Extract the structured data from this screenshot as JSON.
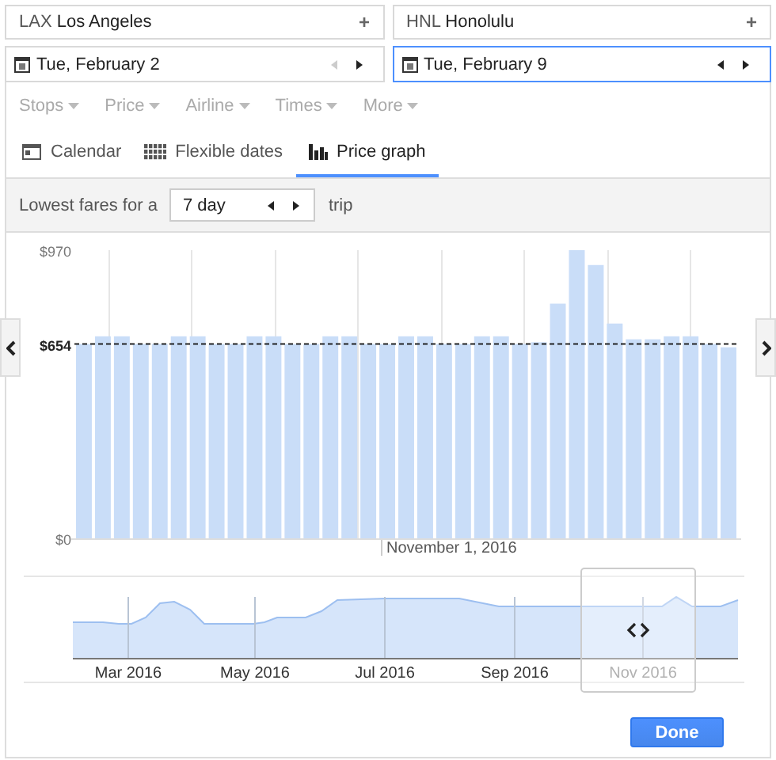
{
  "airports": [
    {
      "code": "LAX",
      "city": "Los Angeles",
      "action": "+"
    },
    {
      "code": "HNL",
      "city": "Honolulu",
      "action": "+"
    }
  ],
  "dates": [
    {
      "label": "Tue, February 2",
      "selected": false,
      "prev_disabled": true
    },
    {
      "label": "Tue, February 9",
      "selected": true,
      "prev_disabled": false
    }
  ],
  "filters": [
    {
      "label": "Stops",
      "disabled": true
    },
    {
      "label": "Price",
      "disabled": true
    },
    {
      "label": "Airline",
      "disabled": true
    },
    {
      "label": "Times",
      "disabled": true
    },
    {
      "label": "More",
      "disabled": true
    }
  ],
  "tabs": [
    {
      "kind": "calendar",
      "label": "Calendar",
      "selected": false
    },
    {
      "kind": "grid",
      "label": "Flexible dates",
      "selected": false
    },
    {
      "kind": "graph",
      "label": "Price graph",
      "selected": true
    }
  ],
  "fare_bar": {
    "prefix": "Lowest fares for a",
    "duration": "7 day",
    "suffix": "trip"
  },
  "price_chart": {
    "chart_data": {
      "type": "bar",
      "values": [
        654,
        680,
        680,
        654,
        654,
        680,
        680,
        654,
        654,
        680,
        680,
        654,
        654,
        680,
        680,
        654,
        654,
        680,
        680,
        654,
        654,
        680,
        680,
        654,
        660,
        790,
        970,
        920,
        723,
        670,
        670,
        680,
        680,
        654,
        643
      ],
      "ylim": [
        0,
        970
      ],
      "yticks": [
        {
          "value": 0,
          "label": "$0"
        },
        {
          "value": 654,
          "label": "$654"
        },
        {
          "value": 970,
          "label": "$970"
        }
      ],
      "ref_lines": [
        {
          "axis": "y",
          "value": 654
        }
      ]
    },
    "x_label": "November 1, 2016"
  },
  "overview": {
    "months": [
      "Mar 2016",
      "May 2016",
      "Jul 2016",
      "Sep 2016",
      "Nov 2016"
    ]
  },
  "done_button": "Done"
}
